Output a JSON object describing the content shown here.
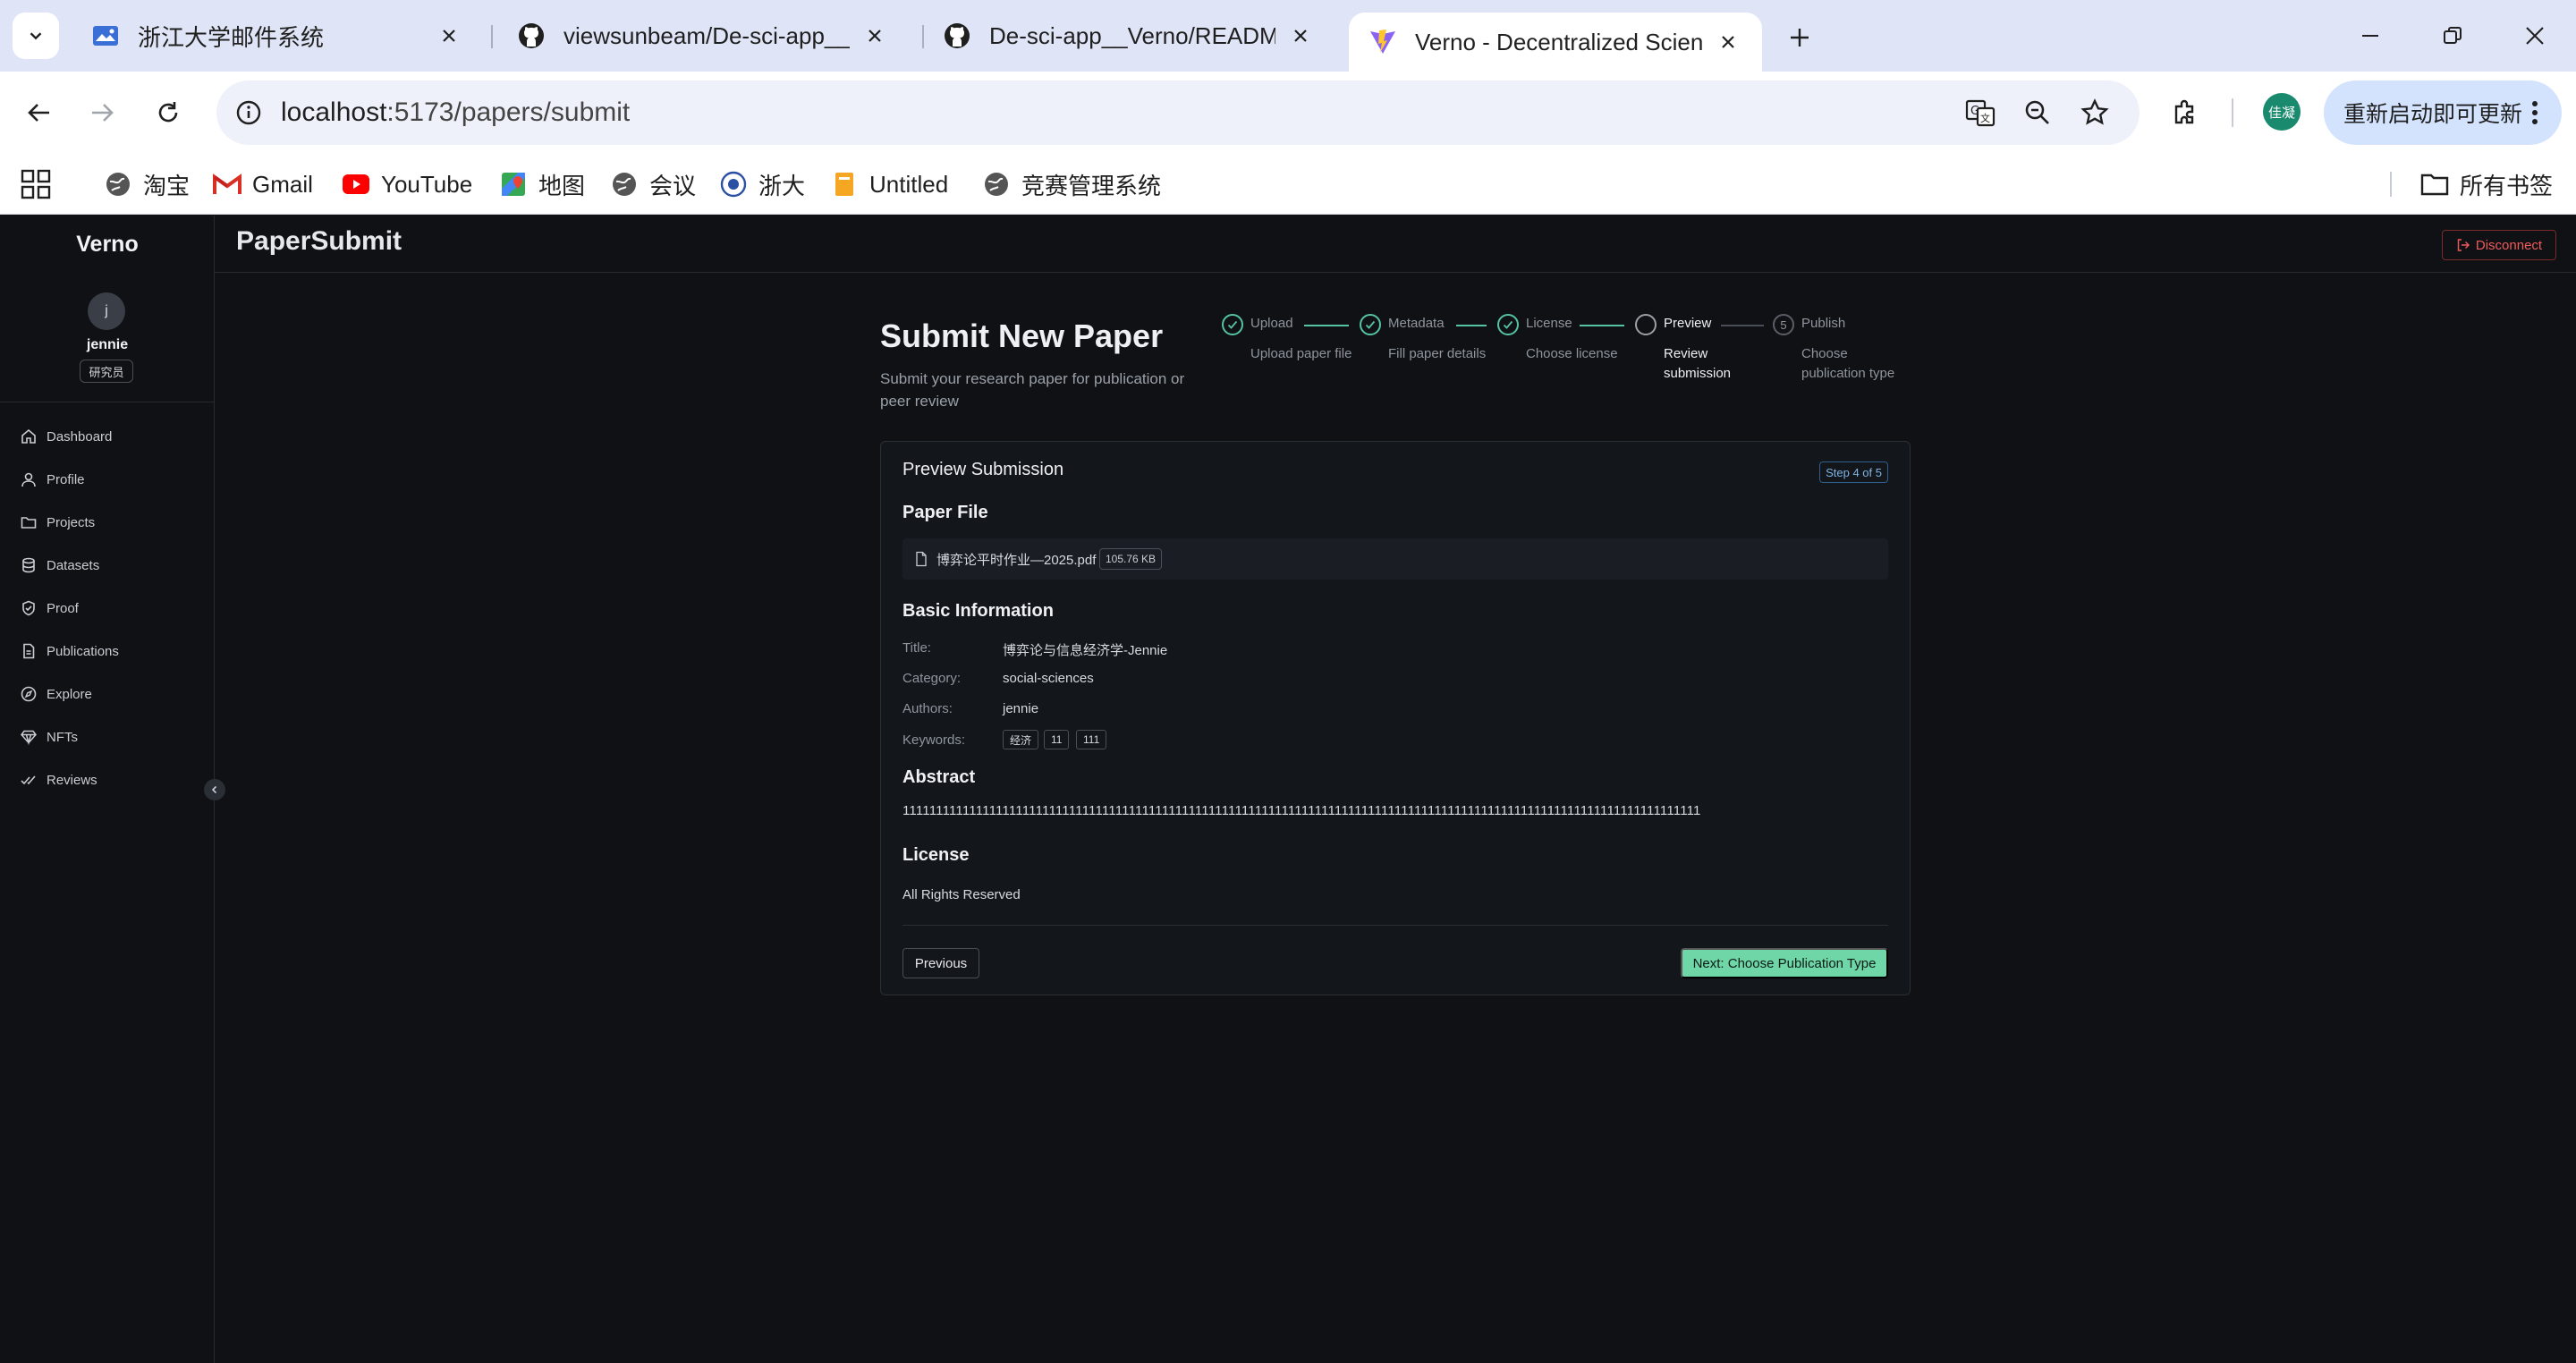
{
  "browser": {
    "tabs": [
      {
        "title": "浙江大学邮件系统"
      },
      {
        "title": "viewsunbeam/De-sci-app__Ve"
      },
      {
        "title": "De-sci-app__Verno/README."
      },
      {
        "title": "Verno - Decentralized Scienc"
      }
    ],
    "url": {
      "host": "localhost",
      "path": ":5173/papers/submit"
    },
    "profile_initials": "佳凝",
    "update_label": "重新启动即可更新",
    "bookmarks": [
      "淘宝",
      "Gmail",
      "YouTube",
      "地图",
      "会议",
      "浙大",
      "Untitled",
      "竞赛管理系统"
    ],
    "all_bookmarks": "所有书签"
  },
  "sidebar": {
    "brand": "Verno",
    "avatar_initial": "j",
    "user_name": "jennie",
    "role": "研究员",
    "items": [
      {
        "label": "Dashboard"
      },
      {
        "label": "Profile"
      },
      {
        "label": "Projects"
      },
      {
        "label": "Datasets"
      },
      {
        "label": "Proof"
      },
      {
        "label": "Publications"
      },
      {
        "label": "Explore"
      },
      {
        "label": "NFTs"
      },
      {
        "label": "Reviews"
      }
    ]
  },
  "header": {
    "title": "PaperSubmit",
    "disconnect": "Disconnect"
  },
  "page": {
    "title": "Submit New Paper",
    "subtitle": "Submit your research paper for publication or peer review"
  },
  "steps": [
    {
      "label": "Upload",
      "desc": "Upload paper file",
      "status": "done"
    },
    {
      "label": "Metadata",
      "desc": "Fill paper details",
      "status": "done"
    },
    {
      "label": "License",
      "desc": "Choose license",
      "status": "done"
    },
    {
      "label": "Preview",
      "desc": "Review submission",
      "status": "current"
    },
    {
      "label": "Publish",
      "desc": "Choose publication type",
      "status": "pending",
      "number": "5"
    }
  ],
  "preview": {
    "card_title": "Preview Submission",
    "step_badge": "Step 4 of 5",
    "file_section": "Paper File",
    "file_name": "博弈论平时作业—2025.pdf",
    "file_size": "105.76 KB",
    "basic_section": "Basic Information",
    "fields": {
      "title_label": "Title:",
      "title_value": "博弈论与信息经济学-Jennie",
      "category_label": "Category:",
      "category_value": "social-sciences",
      "authors_label": "Authors:",
      "authors_value": "jennie",
      "keywords_label": "Keywords:"
    },
    "keywords": [
      "经济",
      "11",
      "111"
    ],
    "abstract_section": "Abstract",
    "abstract": "111111111111111111111111111111111111111111111111111111111111111111111111111111111111111111111111111111111111111111111111",
    "license_section": "License",
    "license": "All Rights Reserved",
    "previous": "Previous",
    "next": "Next: Choose Publication Type"
  },
  "colors": {
    "accent": "#6fd6a8",
    "danger": "#ef5b5b",
    "badge": "#7fb4e4"
  }
}
